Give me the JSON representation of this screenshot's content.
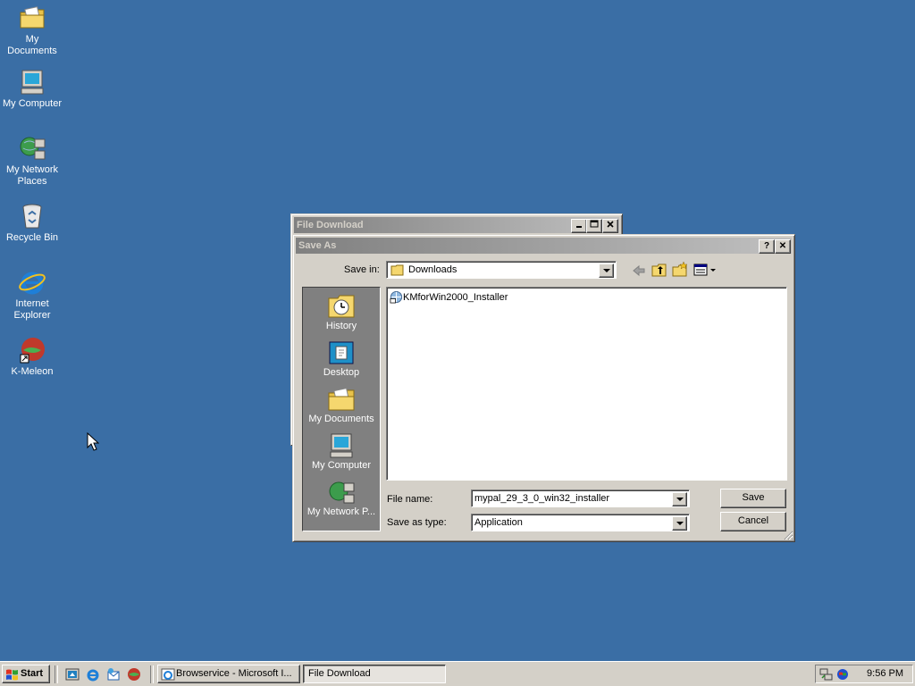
{
  "desktop": {
    "icons": [
      {
        "label": "My Documents"
      },
      {
        "label": "My Computer"
      },
      {
        "label": "My Network Places"
      },
      {
        "label": "Recycle Bin"
      },
      {
        "label": "Internet Explorer"
      },
      {
        "label": "K-Meleon"
      }
    ]
  },
  "file_download_window": {
    "title": "File Download"
  },
  "save_as_dialog": {
    "title": "Save As",
    "save_in_label": "Save in:",
    "save_in_value": "Downloads",
    "places": [
      {
        "label": "History"
      },
      {
        "label": "Desktop"
      },
      {
        "label": "My Documents"
      },
      {
        "label": "My Computer"
      },
      {
        "label": "My Network P..."
      }
    ],
    "files": [
      {
        "name": "KMforWin2000_Installer"
      }
    ],
    "file_name_label": "File name:",
    "file_name_value": "mypal_29_3_0_win32_installer",
    "save_as_type_label": "Save as type:",
    "save_as_type_value": "Application",
    "save_button": "Save",
    "cancel_button": "Cancel",
    "help_button": "?",
    "close_button": "✕"
  },
  "taskbar": {
    "start_label": "Start",
    "tasks": [
      {
        "label": "Browservice - Microsoft I..."
      },
      {
        "label": "File Download"
      }
    ],
    "clock": "9:56 PM"
  }
}
